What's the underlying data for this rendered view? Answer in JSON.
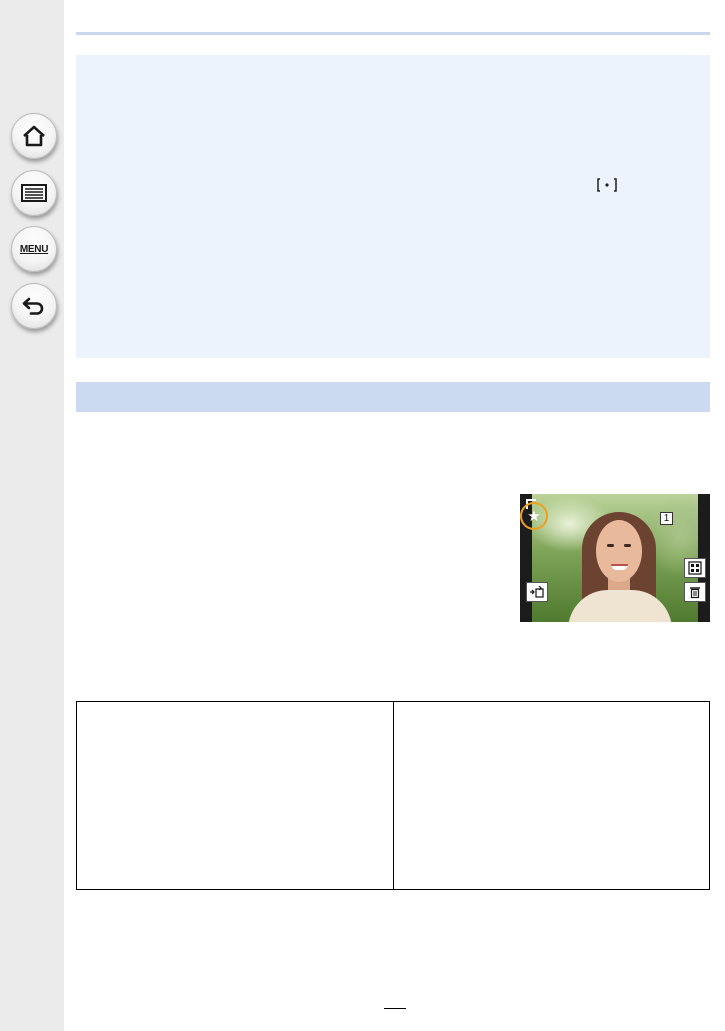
{
  "sidebar": {
    "home_icon": "home-icon",
    "contents_icon": "list-icon",
    "menu_label": "MENU",
    "back_icon": "back-icon"
  },
  "note": {
    "inline_icon": "af-area-icon"
  },
  "preview": {
    "frame_number": "1",
    "favorite_icon": "star-icon",
    "icons": [
      "grid-icon",
      "delete-icon",
      "flip-icon"
    ]
  },
  "page": {
    "number": ""
  },
  "colors": {
    "sidebar": "#ebebeb",
    "note_background": "#edf3fc",
    "section_bar": "#ccdaf1",
    "rule": "#c9d6ec",
    "focus_ring": "#f0a020"
  }
}
